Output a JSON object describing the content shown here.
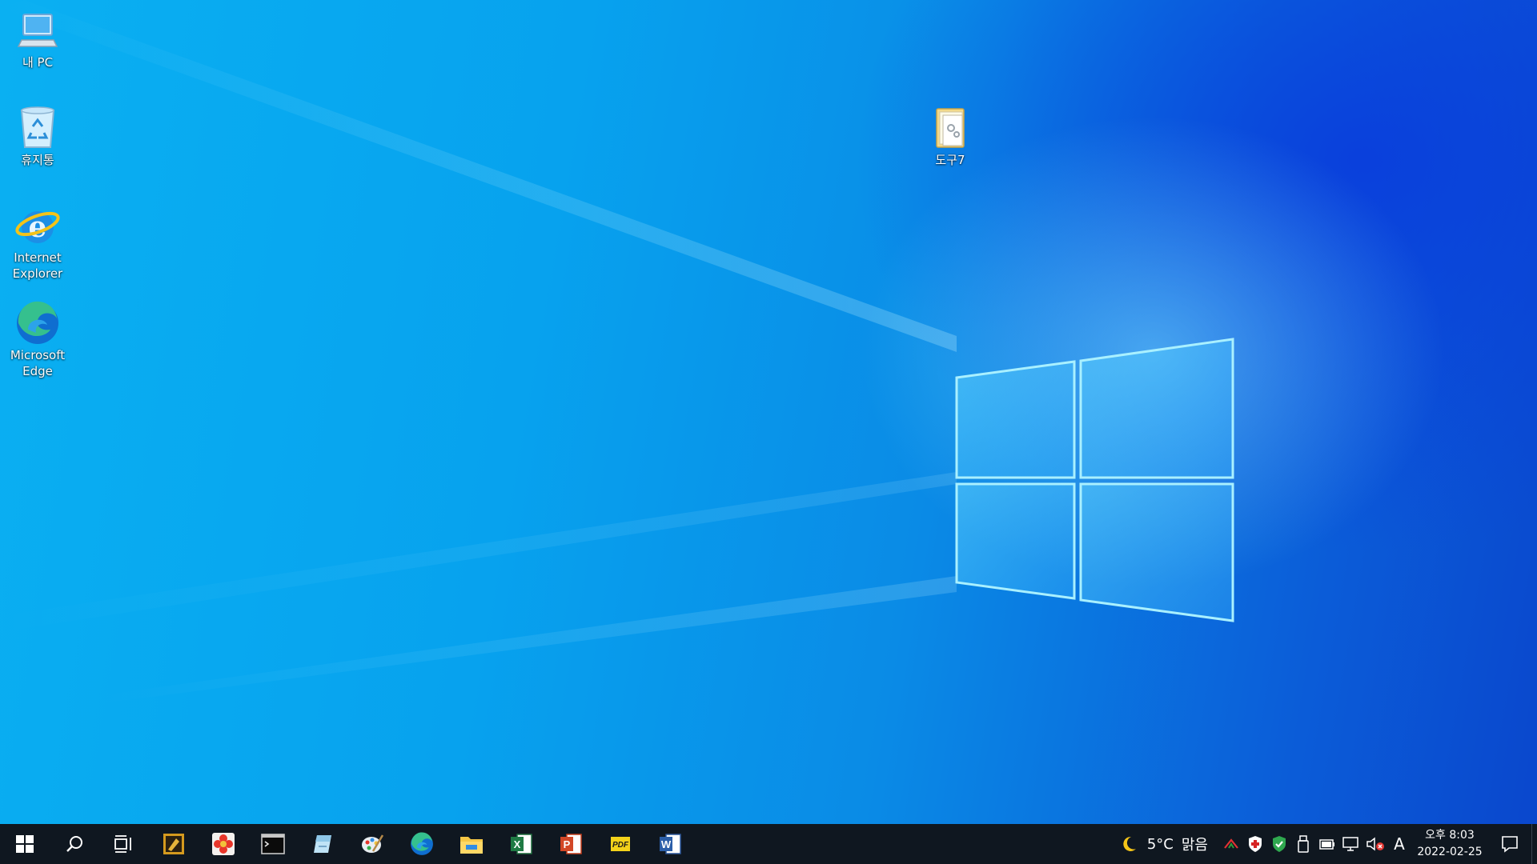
{
  "desktop": {
    "icons": [
      {
        "label": "내 PC",
        "icon": "computer-icon"
      },
      {
        "label": "휴지통",
        "icon": "recycle-bin-icon"
      },
      {
        "label": "Internet\nExplorer",
        "icon": "internet-explorer-icon"
      },
      {
        "label": "Microsoft\nEdge",
        "icon": "edge-icon"
      },
      {
        "label": "도구7",
        "icon": "folder-icon"
      }
    ],
    "wallpaper": {
      "accent": "#0a8be6",
      "glow": "#7fe4ff"
    }
  },
  "taskbar": {
    "background": "#0f1720",
    "apps": [
      {
        "icon": "start-windows-icon"
      },
      {
        "icon": "search-icon"
      },
      {
        "icon": "task-view-icon"
      },
      {
        "icon": "tool-app-icon"
      },
      {
        "icon": "flower-app-icon"
      },
      {
        "icon": "terminal-icon"
      },
      {
        "icon": "notepad-app-icon"
      },
      {
        "icon": "paint-app-icon"
      },
      {
        "icon": "edge-icon"
      },
      {
        "icon": "file-explorer-icon"
      },
      {
        "icon": "excel-icon"
      },
      {
        "icon": "powerpoint-icon"
      },
      {
        "icon": "pdf-app-icon"
      },
      {
        "icon": "word-icon"
      }
    ],
    "tray": {
      "weather_temp": "5°C",
      "weather_desc": "맑음",
      "ime": "A",
      "time": "오후 8:03",
      "date": "2022-02-25"
    }
  }
}
